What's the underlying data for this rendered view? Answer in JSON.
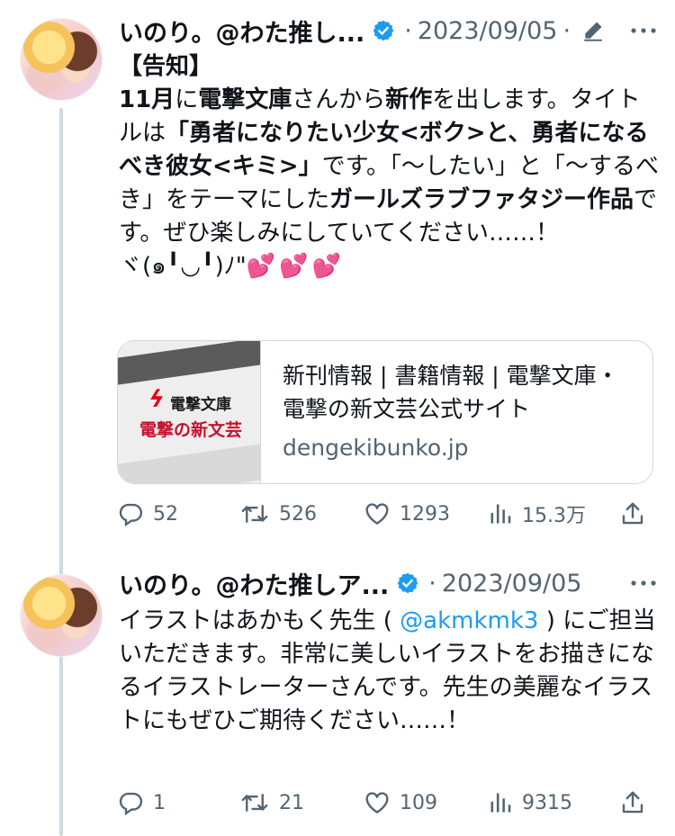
{
  "tweets": [
    {
      "author": "いのり。@わた推し...",
      "date": "2023/09/05",
      "text_segments": [
        {
          "t": "【告知】\n",
          "b": true
        },
        {
          "t": "11月",
          "b": true
        },
        {
          "t": "に",
          "b": false
        },
        {
          "t": "電撃文庫",
          "b": true
        },
        {
          "t": "さんから",
          "b": false
        },
        {
          "t": "新作",
          "b": true
        },
        {
          "t": "を出します。タイトルは",
          "b": false
        },
        {
          "t": "「勇者になりたい少女<ボク>と、勇者になるべき彼女<キミ>」",
          "b": true
        },
        {
          "t": "です。「〜したい」と「〜するべき」をテーマにした",
          "b": false
        },
        {
          "t": "ガールズラブファタジー作品",
          "b": true
        },
        {
          "t": "です。ぜひ楽しみにしていてください……！\nヾ(๑╹◡╹)ﾉ\"",
          "b": false
        }
      ],
      "hearts": "💕💕💕",
      "card": {
        "thumb_line1": "電撃文庫",
        "thumb_line2": "電撃の新文芸",
        "title": "新刊情報 | 書籍情報 | 電撃文庫・電撃の新文芸公式サイト",
        "domain": "dengekibunko.jp"
      },
      "stats": {
        "replies": "52",
        "retweets": "526",
        "likes": "1293",
        "views": "15.3万"
      }
    },
    {
      "author": "いのり。@わた推しア...",
      "date": "2023/09/05",
      "text_before": "イラストはあかもく先生 ( ",
      "mention": "@akmkmk3",
      "text_after": " ) にご担当いただきます。非常に美しいイラストをお描きになるイラストレーターさんです。先生の美麗なイラストにもぜひご期待ください……！",
      "stats": {
        "replies": "1",
        "retweets": "21",
        "likes": "109",
        "views": "9315"
      }
    }
  ],
  "colors": {
    "accent": "#1d9bf0",
    "muted": "#536471",
    "border": "#cfd9de",
    "brand_red": "#e60012"
  },
  "icons": [
    "verified-badge-icon",
    "edit-icon",
    "more-icon",
    "reply-icon",
    "retweet-icon",
    "like-icon",
    "views-icon",
    "share-icon"
  ]
}
